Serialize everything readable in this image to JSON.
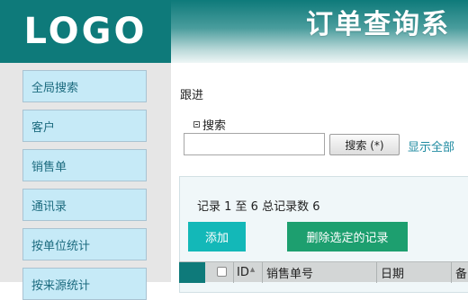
{
  "header": {
    "logo_text": "LOGO",
    "title": "订单查询系"
  },
  "sidebar": {
    "items": [
      {
        "label": "全局搜索"
      },
      {
        "label": "客户"
      },
      {
        "label": "销售单"
      },
      {
        "label": "通讯录"
      },
      {
        "label": "按单位统计"
      },
      {
        "label": "按来源统计"
      }
    ]
  },
  "main": {
    "follow_label": "跟进",
    "search_toggle_label": "搜索",
    "search_input_value": "",
    "search_button_label": "搜索 (*)",
    "show_all_label": "显示全部",
    "records_text": "记录 1 至 6 总记录数 6",
    "add_button_label": "添加",
    "delete_button_label": "删除选定的记录"
  },
  "table": {
    "columns": [
      "ID",
      "销售单号",
      "日期",
      "备"
    ]
  },
  "colors": {
    "brand": "#0e7a7a",
    "sidebar_item_bg": "#c6eaf7",
    "add_button": "#13b8b8",
    "delete_button": "#1d9f6f"
  }
}
